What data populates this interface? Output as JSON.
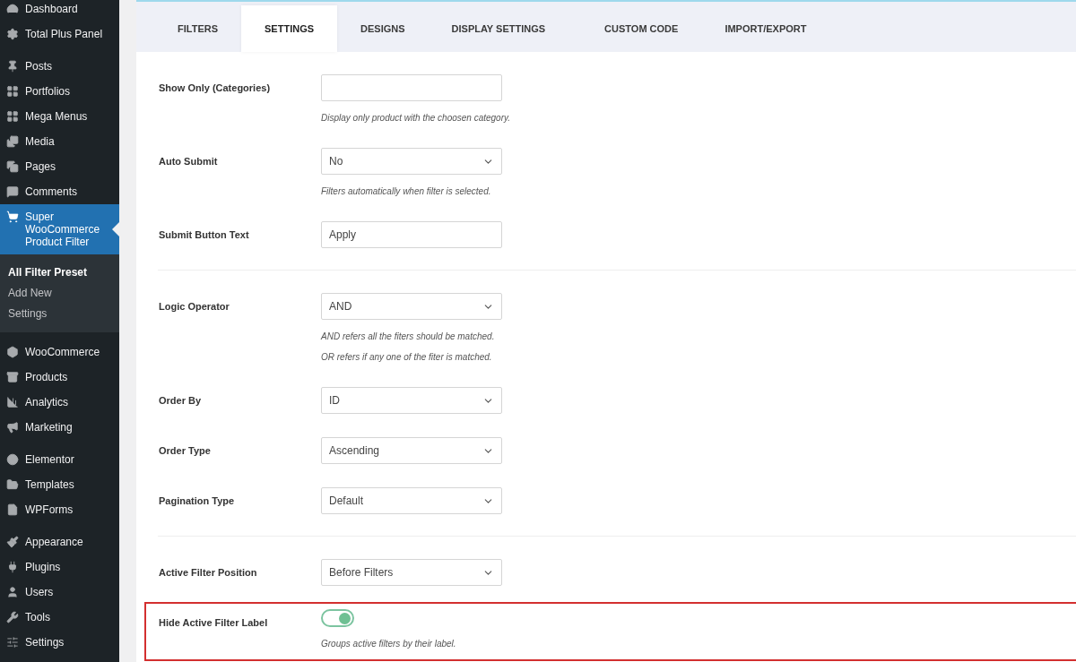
{
  "sidebar": {
    "groups": [
      {
        "items": [
          {
            "label": "Dashboard",
            "selected": false
          },
          {
            "label": "Total Plus Panel",
            "selected": false
          }
        ]
      },
      {
        "items": [
          {
            "label": "Posts",
            "selected": false
          },
          {
            "label": "Portfolios",
            "selected": false
          },
          {
            "label": "Mega Menus",
            "selected": false
          },
          {
            "label": "Media",
            "selected": false
          },
          {
            "label": "Pages",
            "selected": false
          },
          {
            "label": "Comments",
            "selected": false
          },
          {
            "label": "Super WooCommerce Product Filter",
            "selected": true,
            "children": [
              {
                "label": "All Filter Preset",
                "selected": true
              },
              {
                "label": "Add New",
                "selected": false
              },
              {
                "label": "Settings",
                "selected": false
              }
            ]
          }
        ]
      },
      {
        "items": [
          {
            "label": "WooCommerce",
            "selected": false
          },
          {
            "label": "Products",
            "selected": false
          },
          {
            "label": "Analytics",
            "selected": false
          },
          {
            "label": "Marketing",
            "selected": false
          }
        ]
      },
      {
        "items": [
          {
            "label": "Elementor",
            "selected": false
          },
          {
            "label": "Templates",
            "selected": false
          },
          {
            "label": "WPForms",
            "selected": false
          }
        ]
      },
      {
        "items": [
          {
            "label": "Appearance",
            "selected": false
          },
          {
            "label": "Plugins",
            "selected": false
          },
          {
            "label": "Users",
            "selected": false
          },
          {
            "label": "Tools",
            "selected": false
          },
          {
            "label": "Settings",
            "selected": false
          }
        ]
      }
    ]
  },
  "tabs": [
    {
      "label": "FILTERS",
      "selected": false
    },
    {
      "label": "SETTINGS",
      "selected": true
    },
    {
      "label": "DESIGNS",
      "selected": false
    },
    {
      "label": "DISPLAY SETTINGS",
      "selected": false
    },
    {
      "label": "CUSTOM CODE",
      "selected": false
    },
    {
      "label": "IMPORT/EXPORT",
      "selected": false
    }
  ],
  "sections": [
    {
      "fields": [
        {
          "kind": "text",
          "label": "Show Only (Categories)",
          "hints": [
            "Display only product with the choosen category."
          ],
          "highlighted": false
        },
        {
          "kind": "select",
          "label": "Auto Submit",
          "value": "No",
          "hints": [
            "Filters automatically when filter is selected."
          ],
          "highlighted": false
        },
        {
          "kind": "text",
          "label": "Submit Button Text",
          "value": "Apply",
          "highlighted": false
        }
      ]
    },
    {
      "fields": [
        {
          "kind": "select",
          "label": "Logic Operator",
          "value": "AND",
          "hints": [
            "AND refers all the fiters should be matched.",
            "OR refers if any one of the fiter is matched."
          ],
          "highlighted": false
        },
        {
          "kind": "select",
          "label": "Order By",
          "value": "ID",
          "highlighted": false
        },
        {
          "kind": "select",
          "label": "Order Type",
          "value": "Ascending",
          "highlighted": false
        },
        {
          "kind": "select",
          "label": "Pagination Type",
          "value": "Default",
          "highlighted": false
        }
      ]
    },
    {
      "fields": [
        {
          "kind": "select",
          "label": "Active Filter Position",
          "value": "Before Filters",
          "highlighted": false
        },
        {
          "kind": "toggle",
          "label": "Hide Active Filter Label",
          "on": true,
          "hints": [
            "Groups active filters by their label."
          ],
          "highlighted": true
        }
      ]
    }
  ]
}
